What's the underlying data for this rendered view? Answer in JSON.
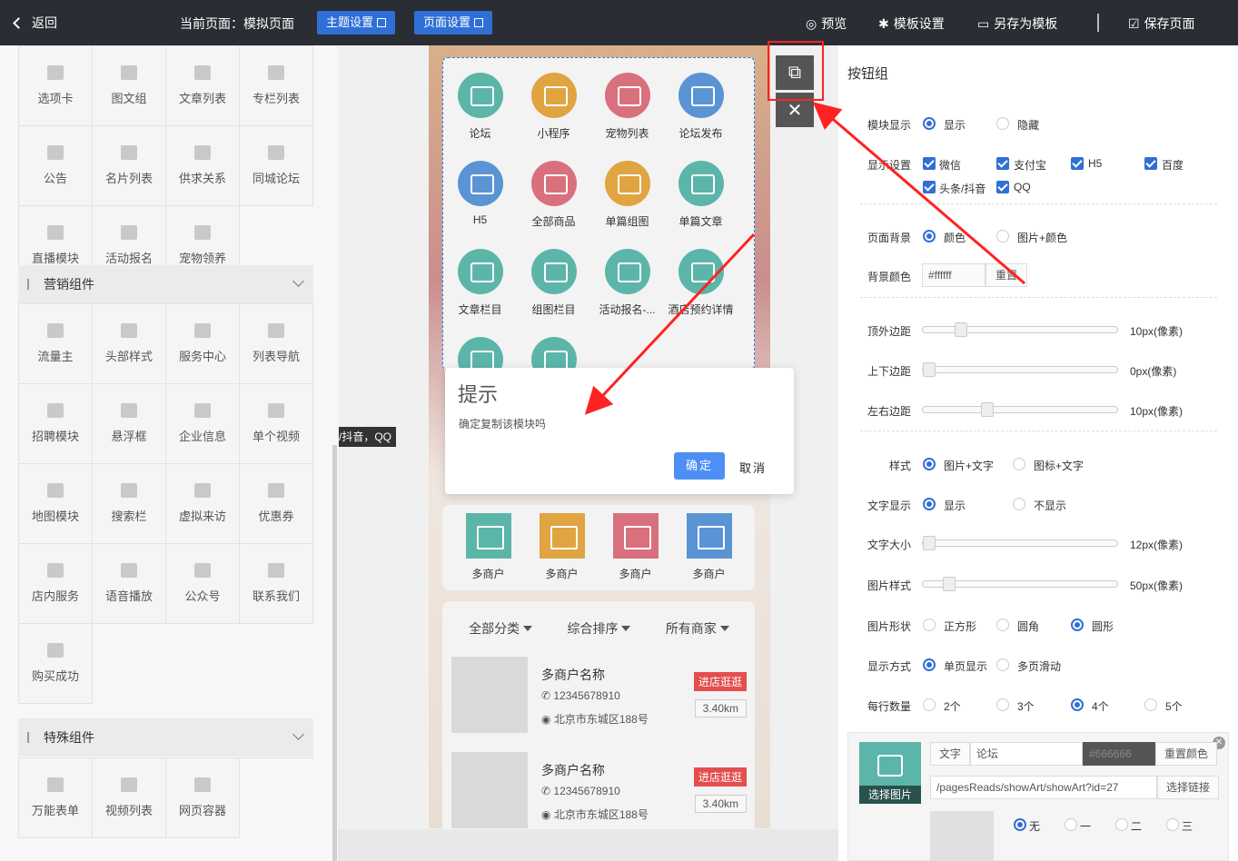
{
  "topbar": {
    "back": "返回",
    "current_page": "当前页面：模拟页面",
    "theme_btn": "主题设置",
    "page_btn": "页面设置",
    "preview": "预览",
    "template_settings": "模板设置",
    "save_as_template": "另存为模板",
    "save_page": "保存页面"
  },
  "left": {
    "grid1": [
      "选项卡",
      "图文组",
      "文章列表",
      "专栏列表",
      "公告",
      "名片列表",
      "供求关系",
      "同城论坛",
      "直播模块",
      "活动报名",
      "宠物领养"
    ],
    "section_marketing": "营销组件",
    "grid2": [
      "流量主",
      "头部样式",
      "服务中心",
      "列表导航",
      "招聘模块",
      "悬浮框",
      "企业信息",
      "单个视频",
      "地图模块",
      "搜索栏",
      "虚拟来访",
      "优惠券",
      "店内服务",
      "语音播放",
      "公众号",
      "联系我们",
      "购买成功"
    ],
    "section_special": "特殊组件",
    "grid3": [
      "万能表单",
      "视频列表",
      "网页容器"
    ],
    "tooltip": "/抖音，QQ"
  },
  "phone": {
    "icons": [
      "论坛",
      "小程序",
      "宠物列表",
      "论坛发布",
      "H5",
      "全部商品",
      "单篇组图",
      "单篇文章",
      "文章栏目",
      "组图栏目",
      "活动报名-...",
      "酒店预约详情"
    ],
    "icon_colors": [
      "#5cb5a9",
      "#e0a440",
      "#d9707e",
      "#5a94d4",
      "#5a94d4",
      "#d9707e",
      "#e0a440",
      "#5cb5a9",
      "#5cb5a9",
      "#5cb5a9",
      "#5cb5a9",
      "#5cb5a9"
    ],
    "shops": [
      "多商户",
      "多商户",
      "多商户",
      "多商户"
    ],
    "shop_colors": [
      "#5cb5a9",
      "#e0a440",
      "#d9707e",
      "#5a94d4"
    ],
    "filters": [
      "全部分类",
      "综合排序",
      "所有商家"
    ],
    "merchants": [
      {
        "name": "多商户名称",
        "tel": "12345678910",
        "addr": "北京市东城区188号",
        "go": "进店逛逛",
        "dist": "3.40km"
      },
      {
        "name": "多商户名称",
        "tel": "12345678910",
        "addr": "北京市东城区188号",
        "go": "进店逛逛",
        "dist": "3.40km"
      }
    ]
  },
  "modal": {
    "title": "提示",
    "message": "确定复制该模块吗",
    "ok": "确定",
    "cancel": "取消"
  },
  "right": {
    "title": "按钮组",
    "module_display": "模块显示",
    "show": "显示",
    "hide": "隐藏",
    "display_settings": "显示设置",
    "platforms": [
      "微信",
      "支付宝",
      "H5",
      "百度",
      "头条/抖音",
      "QQ"
    ],
    "page_bg": "页面背景",
    "color": "颜色",
    "image_color": "图片+颜色",
    "bg_color": "背景颜色",
    "bg_value": "#ffffff",
    "reset": "重置",
    "top_margin": "顶外边距",
    "top_margin_val": "10px(像素)",
    "vert_margin": "上下边距",
    "vert_margin_val": "0px(像素)",
    "lr_margin": "左右边距",
    "lr_margin_val": "10px(像素)",
    "style": "样式",
    "style_img_text": "图片+文字",
    "style_icon_text": "图标+文字",
    "text_display": "文字显示",
    "no_show": "不显示",
    "text_size": "文字大小",
    "text_size_val": "12px(像素)",
    "img_style": "图片样式",
    "img_style_val": "50px(像素)",
    "img_shape": "图片形状",
    "square": "正方形",
    "rounded": "圆角",
    "circle": "圆形",
    "display_mode": "显示方式",
    "single_page": "单页显示",
    "multi_page": "多页滑动",
    "per_row": "每行数量",
    "per_row_opts": [
      "2个",
      "3个",
      "4个",
      "5个"
    ],
    "item_text_label": "文字",
    "item_text": "论坛",
    "item_color": "#666666",
    "reset_color": "重置颜色",
    "choose_img": "选择图片",
    "link": "/pagesReads/showArt/showArt?id=27",
    "choose_link": "选择链接",
    "badge_opts": [
      "无",
      "一",
      "二",
      "三"
    ]
  }
}
